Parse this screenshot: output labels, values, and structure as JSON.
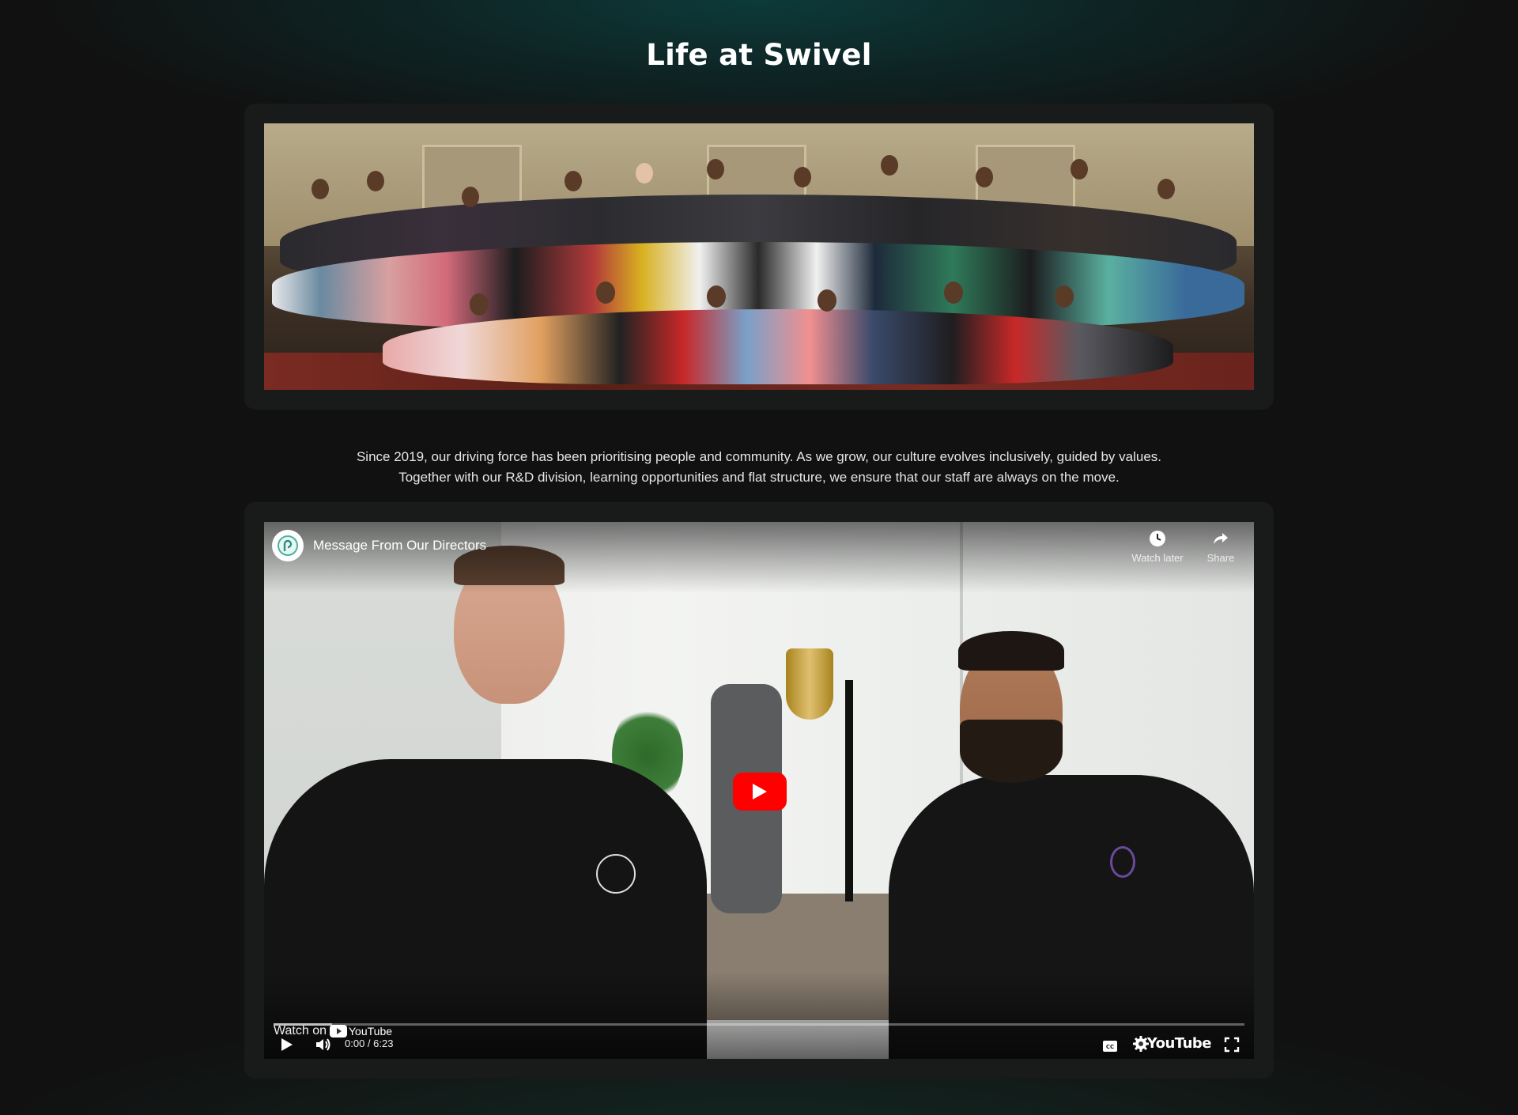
{
  "section": {
    "title": "Life at Swivel"
  },
  "description": {
    "line1": "Since 2019, our driving force has been prioritising people and community. As we grow, our culture evolves inclusively, guided by values.",
    "line2": "Together with our R&D division, learning opportunities and flat structure, we ensure that our staff are always on the move."
  },
  "video": {
    "title": "Message From Our Directors",
    "watch_later_label": "Watch later",
    "share_label": "Share",
    "watch_on_label": "Watch on",
    "youtube_small_label": "YouTube",
    "time_display": "0:00 / 6:23",
    "youtube_brand": "YouTube",
    "progress": 0.0,
    "buffered": 0.06,
    "play_button_color": "#ff0000"
  }
}
